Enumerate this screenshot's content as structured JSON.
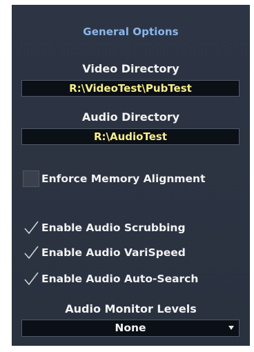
{
  "panel": {
    "title": "General Options"
  },
  "video_directory": {
    "label": "Video Directory",
    "value": "R:\\VideoTest\\PubTest"
  },
  "audio_directory": {
    "label": "Audio Directory",
    "value": "R:\\AudioTest"
  },
  "options": [
    {
      "label": "Enforce Memory Alignment",
      "checked": false
    },
    {
      "label": "Enable Audio Scrubbing",
      "checked": true
    },
    {
      "label": "Enable Audio VariSpeed",
      "checked": true
    },
    {
      "label": "Enable Audio Auto-Search",
      "checked": true
    }
  ],
  "audio_monitor_levels": {
    "label": "Audio Monitor Levels",
    "selected": "None"
  },
  "colors": {
    "panel_bg": "#2b3340",
    "title": "#8ab6ea",
    "path_text": "#f6ee88",
    "field_bg": "#0b0f16"
  }
}
